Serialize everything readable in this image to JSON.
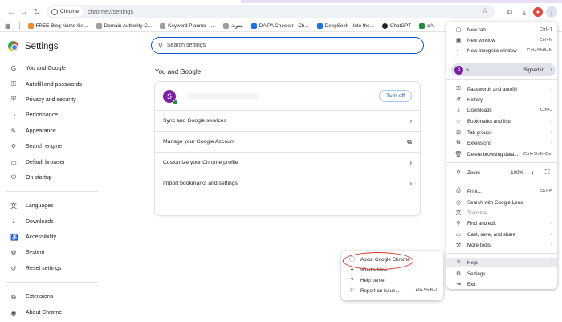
{
  "toolbar": {
    "chip_label": "Chrome",
    "url": "chrome://settings"
  },
  "bookmarks": [
    {
      "label": "FREE Blog Name Ge...",
      "color": "orange"
    },
    {
      "label": "Domain Authority C...",
      "color": "grey"
    },
    {
      "label": "Keyword Planner - ...",
      "color": "grey"
    },
    {
      "label": "مدونة",
      "color": "grey"
    },
    {
      "label": "DA PA Checker - Ch...",
      "color": "blue"
    },
    {
      "label": "DeepSeek - Into the...",
      "color": "blue"
    },
    {
      "label": "ChatGPT",
      "color": "black"
    },
    {
      "label": "eAI",
      "color": "green"
    }
  ],
  "settings": {
    "title": "Settings",
    "search_placeholder": "Search settings",
    "sidebar": [
      {
        "label": "You and Google",
        "icon": "G"
      },
      {
        "label": "Autofill and passwords",
        "icon": "⚿"
      },
      {
        "label": "Privacy and security",
        "icon": "⛨"
      },
      {
        "label": "Performance",
        "icon": "◔"
      },
      {
        "label": "Appearance",
        "icon": "✎"
      },
      {
        "label": "Search engine",
        "icon": "⚲"
      },
      {
        "label": "Default browser",
        "icon": "▭"
      },
      {
        "label": "On startup",
        "icon": "⏻"
      },
      {
        "label": "Languages",
        "icon": "文"
      },
      {
        "label": "Downloads",
        "icon": "⤓"
      },
      {
        "label": "Accessibility",
        "icon": "♿"
      },
      {
        "label": "System",
        "icon": "⚙"
      },
      {
        "label": "Reset settings",
        "icon": "↺"
      },
      {
        "label": "Extensions",
        "icon": "⧉"
      },
      {
        "label": "About Chrome",
        "icon": "◉"
      }
    ],
    "section_title": "You and Google",
    "avatar_letter": "S",
    "turn_off_label": "Turn off",
    "rows": [
      {
        "label": "Sync and Google services",
        "icon": "›"
      },
      {
        "label": "Manage your Google Account",
        "icon": "⧉"
      },
      {
        "label": "Customize your Chrome profile",
        "icon": "›"
      },
      {
        "label": "Import bookmarks and settings",
        "icon": "›"
      }
    ]
  },
  "menu": {
    "items_top": [
      {
        "label": "New tab",
        "shortcut": "Ctrl+T",
        "icon": "▢"
      },
      {
        "label": "New window",
        "shortcut": "Ctrl+N",
        "icon": "▣"
      },
      {
        "label": "New Incognito window",
        "shortcut": "Ctrl+Shift+N",
        "icon": "◐"
      }
    ],
    "profile": {
      "letter": "S",
      "name": "s",
      "status": "Signed in"
    },
    "items_mid": [
      {
        "label": "Passwords and autofill",
        "shortcut": "›",
        "icon": "⚿"
      },
      {
        "label": "History",
        "shortcut": "›",
        "icon": "↺"
      },
      {
        "label": "Downloads",
        "shortcut": "Ctrl+J",
        "icon": "⤓"
      },
      {
        "label": "Bookmarks and lists",
        "shortcut": "›",
        "icon": "☆"
      },
      {
        "label": "Tab groups",
        "shortcut": "›",
        "icon": "⊞"
      },
      {
        "label": "Extensions",
        "shortcut": "›",
        "icon": "⧉"
      },
      {
        "label": "Delete browsing data...",
        "shortcut": "Ctrl+Shift+Del",
        "icon": "🗑"
      }
    ],
    "zoom": {
      "label": "Zoom",
      "minus": "−",
      "value": "100%",
      "plus": "+",
      "fullscreen": "⛶"
    },
    "items_tools": [
      {
        "label": "Print...",
        "shortcut": "Ctrl+P",
        "icon": "⎙",
        "dim": false
      },
      {
        "label": "Search with Google Lens",
        "shortcut": "",
        "icon": "◎",
        "dim": false
      },
      {
        "label": "Translate...",
        "shortcut": "",
        "icon": "文",
        "dim": true
      },
      {
        "label": "Find and edit",
        "shortcut": "›",
        "icon": "⚲",
        "dim": false
      },
      {
        "label": "Cast, save, and share",
        "shortcut": "›",
        "icon": "▭",
        "dim": false
      },
      {
        "label": "More tools",
        "shortcut": "›",
        "icon": "⚒",
        "dim": false
      }
    ],
    "items_bottom": [
      {
        "label": "Help",
        "shortcut": "›",
        "icon": "?"
      },
      {
        "label": "Settings",
        "shortcut": "",
        "icon": "⚙"
      },
      {
        "label": "Exit",
        "shortcut": "",
        "icon": "⇥"
      }
    ]
  },
  "help_menu": [
    {
      "label": "About Google Chrome",
      "shortcut": "",
      "icon": "ⓘ"
    },
    {
      "label": "What's New",
      "shortcut": "",
      "icon": "✦"
    },
    {
      "label": "Help center",
      "shortcut": "",
      "icon": "?"
    },
    {
      "label": "Report an issue...",
      "shortcut": "Alt+Shift+I",
      "icon": "⚐"
    }
  ]
}
